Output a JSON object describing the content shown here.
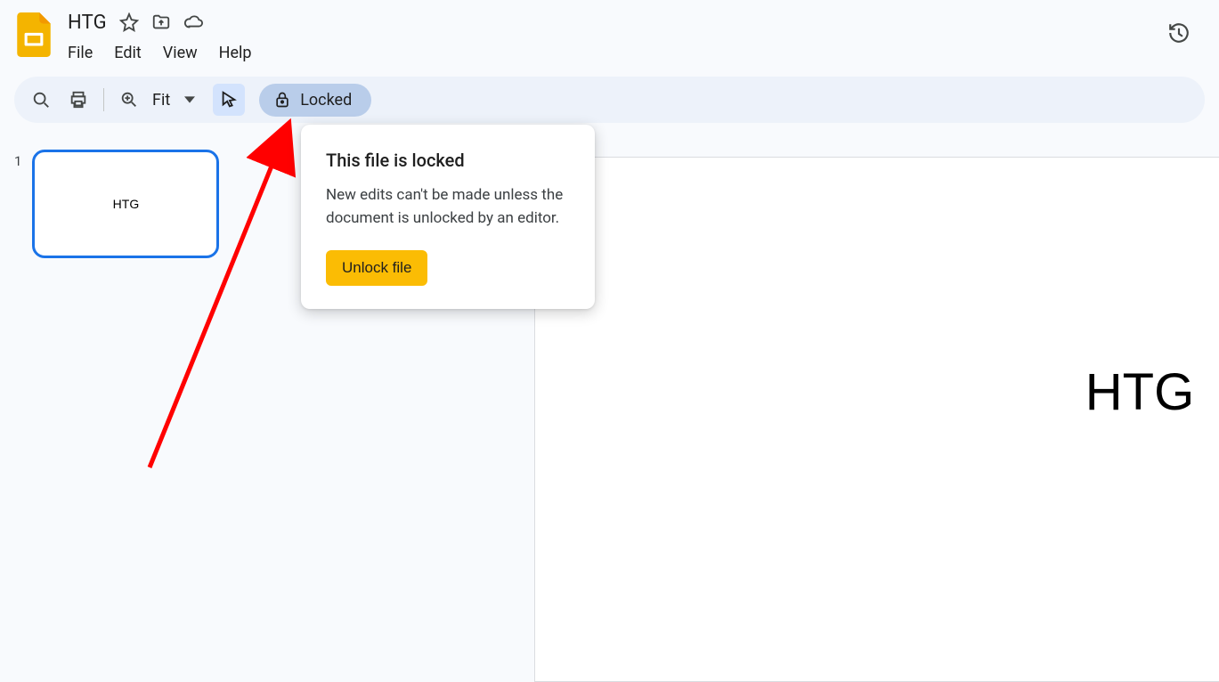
{
  "doc": {
    "title": "HTG"
  },
  "menu": {
    "file": "File",
    "edit": "Edit",
    "view": "View",
    "help": "Help"
  },
  "toolbar": {
    "zoom_label": "Fit",
    "locked_label": "Locked"
  },
  "slides": {
    "thumb_number": "1",
    "thumb_text": "HTG",
    "canvas_title": "HTG"
  },
  "popover": {
    "title": "This file is locked",
    "body": "New edits can't be made unless the document is unlocked by an editor.",
    "button": "Unlock file"
  }
}
